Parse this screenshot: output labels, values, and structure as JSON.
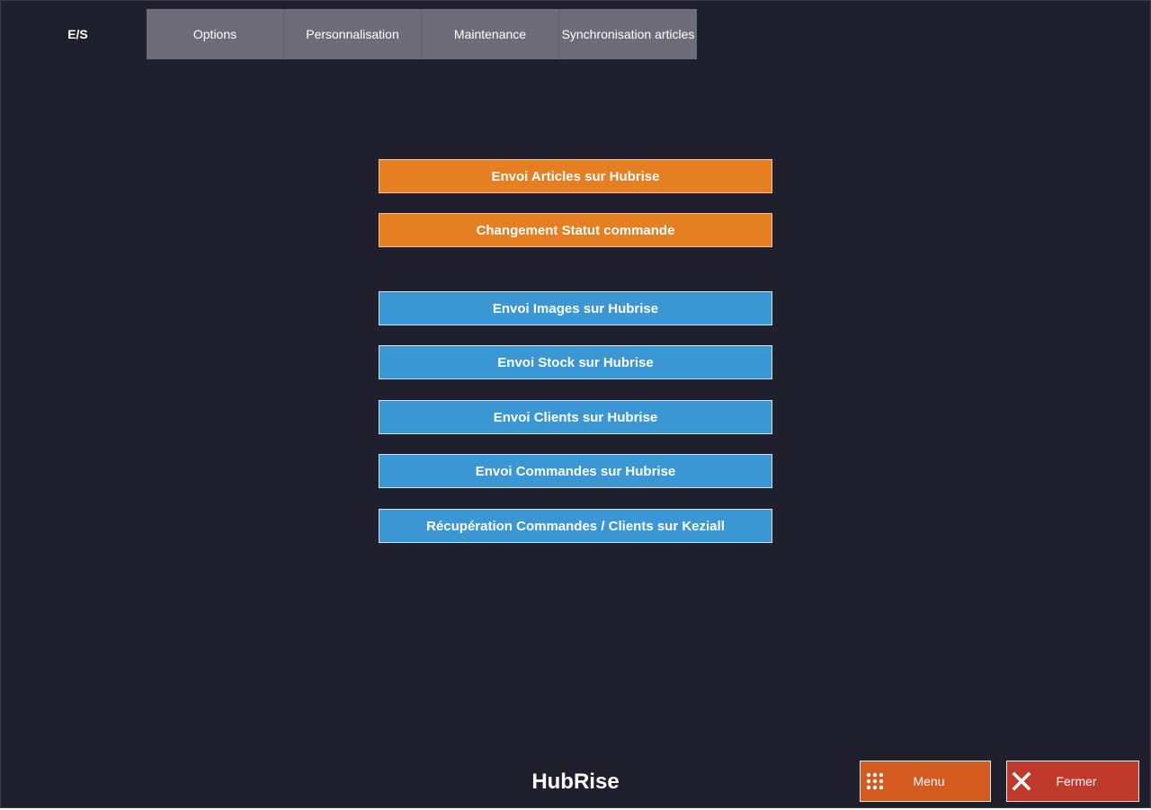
{
  "tabs": [
    {
      "label": "E/S",
      "active": true
    },
    {
      "label": "Options",
      "active": false
    },
    {
      "label": "Personnalisation",
      "active": false
    },
    {
      "label": "Maintenance",
      "active": false
    },
    {
      "label": "Synchronisation articles",
      "active": false
    }
  ],
  "actions": [
    {
      "label": "Envoi Articles sur Hubrise",
      "color": "orange"
    },
    {
      "label": "Changement Statut commande",
      "color": "orange"
    },
    {
      "label": "Envoi Images sur Hubrise",
      "color": "blue"
    },
    {
      "label": "Envoi Stock sur Hubrise",
      "color": "blue"
    },
    {
      "label": "Envoi Clients sur Hubrise",
      "color": "blue"
    },
    {
      "label": "Envoi Commandes sur Hubrise",
      "color": "blue"
    },
    {
      "label": "Récupération Commandes / Clients sur Keziall",
      "color": "blue"
    }
  ],
  "footer": {
    "title": "HubRise",
    "menu_label": "Menu",
    "menu_icon": "grid-icon",
    "close_label": "Fermer",
    "close_icon": "close-icon"
  },
  "colors": {
    "background": "#1f1f2e",
    "orange": "#e67e22",
    "blue": "#3a97d4",
    "menu": "#d35b1f",
    "close": "#c0392b",
    "tab_inactive": "#6d6c78"
  }
}
